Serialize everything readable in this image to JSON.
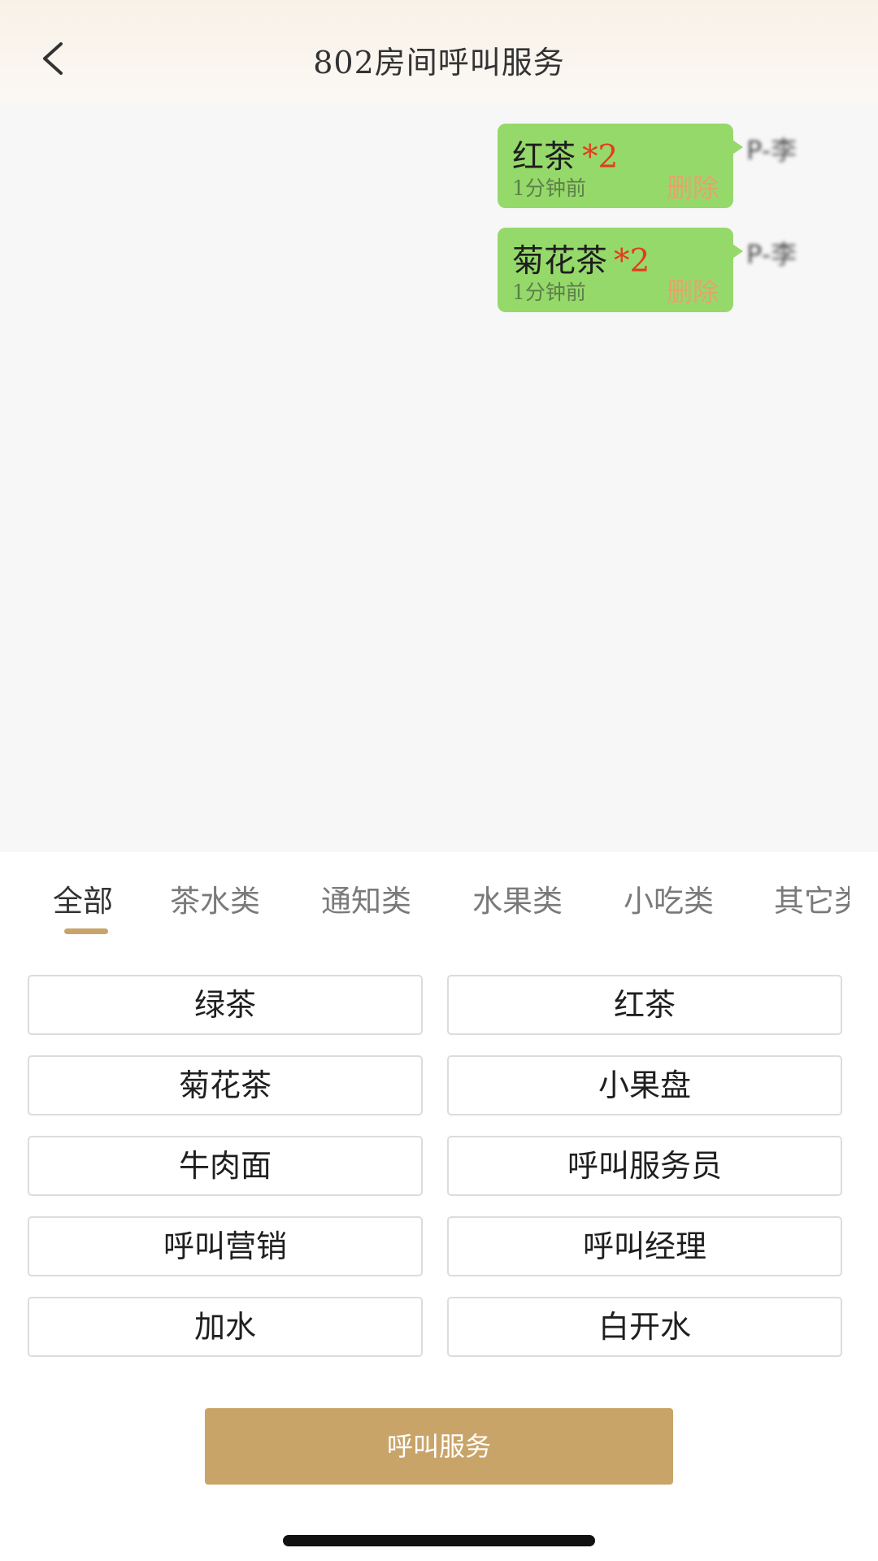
{
  "header": {
    "title": "802房间呼叫服务"
  },
  "messages": [
    {
      "item": "红茶",
      "qty": "*2",
      "time": "1分钟前",
      "delete_label": "删除",
      "sender": "P-李"
    },
    {
      "item": "菊花茶",
      "qty": "*2",
      "time": "1分钟前",
      "delete_label": "删除",
      "sender": "P-李"
    }
  ],
  "tabs": [
    {
      "label": "全部",
      "active": true
    },
    {
      "label": "茶水类"
    },
    {
      "label": "通知类"
    },
    {
      "label": "水果类"
    },
    {
      "label": "小吃类"
    },
    {
      "label": "其它类"
    }
  ],
  "options": [
    "绿茶",
    "红茶",
    "菊花茶",
    "小果盘",
    "牛肉面",
    "呼叫服务员",
    "呼叫营销",
    "呼叫经理",
    "加水",
    "白开水"
  ],
  "call_button": "呼叫服务",
  "colors": {
    "accent": "#c9a469",
    "bubble": "#95d96b",
    "qty": "#e53b1e",
    "delete": "#e6a36b"
  }
}
